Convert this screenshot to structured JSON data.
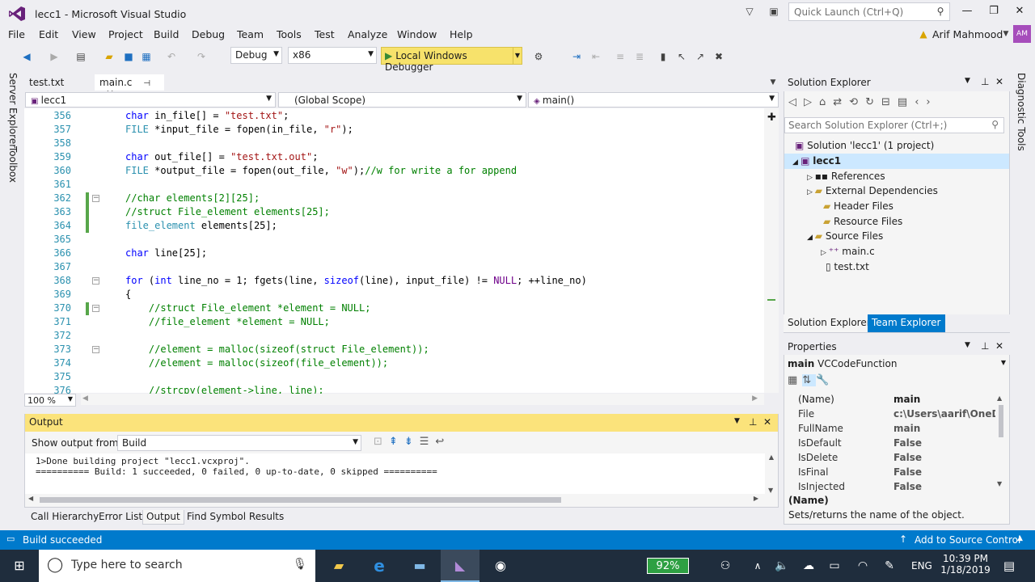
{
  "window": {
    "title": "lecc1 - Microsoft Visual Studio",
    "quick_launch_placeholder": "Quick Launch (Ctrl+Q)"
  },
  "menu": [
    "File",
    "Edit",
    "View",
    "Project",
    "Build",
    "Debug",
    "Team",
    "Tools",
    "Test",
    "Analyze",
    "Window",
    "Help"
  ],
  "user": {
    "name": "Arif Mahmood",
    "initials": "AM"
  },
  "toolbar": {
    "configuration": "Debug",
    "platform": "x86",
    "run_label": "Local Windows Debugger"
  },
  "editor": {
    "tabs": [
      {
        "label": "test.txt"
      },
      {
        "label": "main.c",
        "active": true
      }
    ],
    "nav": {
      "project": "lecc1",
      "scope": "(Global Scope)",
      "member": "main()"
    },
    "zoom": "100 %",
    "lines": [
      {
        "n": "356",
        "text": "char in_file[] = \"test.txt\";"
      },
      {
        "n": "357",
        "text": "FILE *input_file = fopen(in_file, \"r\");"
      },
      {
        "n": "358",
        "text": ""
      },
      {
        "n": "359",
        "text": "char out_file[] = \"test.txt.out\";"
      },
      {
        "n": "360",
        "text": "FILE *output_file = fopen(out_file, \"w\");//w for write a for append"
      },
      {
        "n": "361",
        "text": ""
      },
      {
        "n": "362",
        "text": "//char elements[2][25];"
      },
      {
        "n": "363",
        "text": "//struct File_element elements[25];"
      },
      {
        "n": "364",
        "text": "file_element elements[25];"
      },
      {
        "n": "365",
        "text": ""
      },
      {
        "n": "366",
        "text": "char line[25];"
      },
      {
        "n": "367",
        "text": ""
      },
      {
        "n": "368",
        "text": "for (int line_no = 1; fgets(line, sizeof(line), input_file) != NULL; ++line_no)"
      },
      {
        "n": "369",
        "text": "{"
      },
      {
        "n": "370",
        "text": "    //struct File_element *element = NULL;"
      },
      {
        "n": "371",
        "text": "    //file_element *element = NULL;"
      },
      {
        "n": "372",
        "text": ""
      },
      {
        "n": "373",
        "text": "    //element = malloc(sizeof(struct File_element));"
      },
      {
        "n": "374",
        "text": "    //element = malloc(sizeof(file_element));"
      },
      {
        "n": "375",
        "text": ""
      },
      {
        "n": "376",
        "text": "    //strcpy(element->line, line);"
      }
    ]
  },
  "solution_explorer": {
    "title": "Solution Explorer",
    "search_placeholder": "Search Solution Explorer (Ctrl+;)",
    "solution": "Solution 'lecc1' (1 project)",
    "project": "lecc1",
    "items": [
      "References",
      "External Dependencies",
      "Header Files",
      "Resource Files",
      "Source Files",
      "main.c",
      "test.txt"
    ],
    "tabs": [
      "Solution Explorer",
      "Team Explorer"
    ]
  },
  "properties": {
    "title": "Properties",
    "object_name": "main",
    "object_type": "VCCodeFunction",
    "rows": [
      {
        "name": "(Name)",
        "value": "main"
      },
      {
        "name": "File",
        "value": "c:\\Users\\aarif\\OneDri"
      },
      {
        "name": "FullName",
        "value": "main"
      },
      {
        "name": "IsDefault",
        "value": "False"
      },
      {
        "name": "IsDelete",
        "value": "False"
      },
      {
        "name": "IsFinal",
        "value": "False"
      },
      {
        "name": "IsInjected",
        "value": "False"
      }
    ],
    "desc_title": "(Name)",
    "desc_text": "Sets/returns the name of the object."
  },
  "output": {
    "title": "Output",
    "show_from_label": "Show output from:",
    "source": "Build",
    "lines": [
      "1>Done building project \"lecc1.vcxproj\".",
      "========== Build: 1 succeeded, 0 failed, 0 up-to-date, 0 skipped =========="
    ],
    "tabs": [
      "Call Hierarchy",
      "Error List",
      "Output",
      "Find Symbol Results"
    ]
  },
  "left_rail": [
    "Server Explorer",
    "Toolbox"
  ],
  "right_rail": [
    "Diagnostic Tools"
  ],
  "status": {
    "text": "Build succeeded",
    "source_control": "Add to Source Control"
  },
  "taskbar": {
    "search_placeholder": "Type here to search",
    "battery": "92%",
    "language": "ENG",
    "time": "10:39 PM",
    "date": "1/18/2019"
  },
  "colors": {
    "accent": "#007acc",
    "run_button": "#f7e26b",
    "output_header": "#fbe37b",
    "comment": "#008000",
    "keyword": "#0000ff",
    "string": "#a31515"
  }
}
